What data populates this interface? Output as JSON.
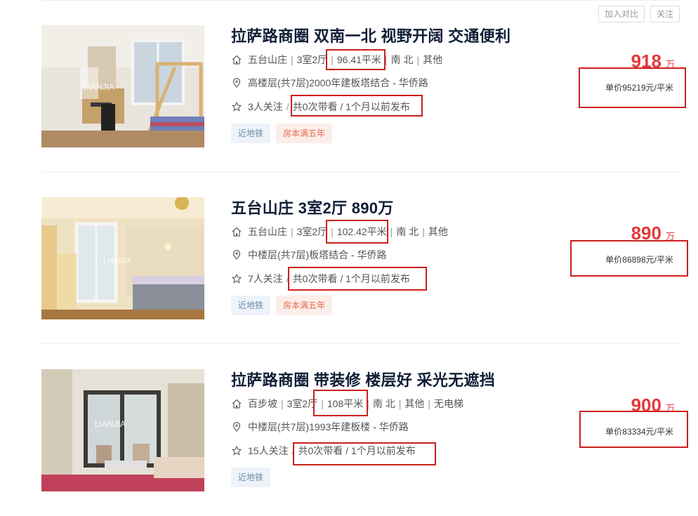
{
  "actions": {
    "compare": "加入对比",
    "follow": "关注"
  },
  "listings": [
    {
      "title": "拉萨路商圈 双南一北 视野开阔 交通便利",
      "community": "五台山庄",
      "layout": "3室2厅",
      "area": "96.41平米",
      "orientation": "南 北",
      "decor": "其他",
      "floor": "高楼层(共7层)2000年建板塔结合 - 华侨路",
      "followers": "3人关注",
      "visits": "共0次带看 / 1个月以前发布",
      "tags": [
        "近地铁",
        "房本满五年"
      ],
      "total_price": "918",
      "price_unit": "万",
      "unit_price": "单价95219元/平米"
    },
    {
      "title": "五台山庄 3室2厅 890万",
      "community": "五台山庄",
      "layout": "3室2厅",
      "area": "102.42平米",
      "orientation": "南 北",
      "decor": "其他",
      "floor": "中楼层(共7层)板塔结合 - 华侨路",
      "followers": "7人关注",
      "visits": "共0次带看 / 1个月以前发布",
      "tags": [
        "近地铁",
        "房本满五年"
      ],
      "total_price": "890",
      "price_unit": "万",
      "unit_price": "单价86898元/平米"
    },
    {
      "title": "拉萨路商圈 带装修 楼层好 采光无遮挡",
      "community": "百步坡",
      "layout": "3室2厅",
      "area": "108平米",
      "orientation": "南 北",
      "decor": "其他",
      "elevator": "无电梯",
      "floor": "中楼层(共7层)1993年建板楼 - 华侨路",
      "followers": "15人关注",
      "visits": "共0次带看 / 1个月以前发布",
      "tags": [
        "近地铁"
      ],
      "total_price": "900",
      "price_unit": "万",
      "unit_price": "单价83334元/平米"
    }
  ],
  "watermark": "LIANJIA"
}
